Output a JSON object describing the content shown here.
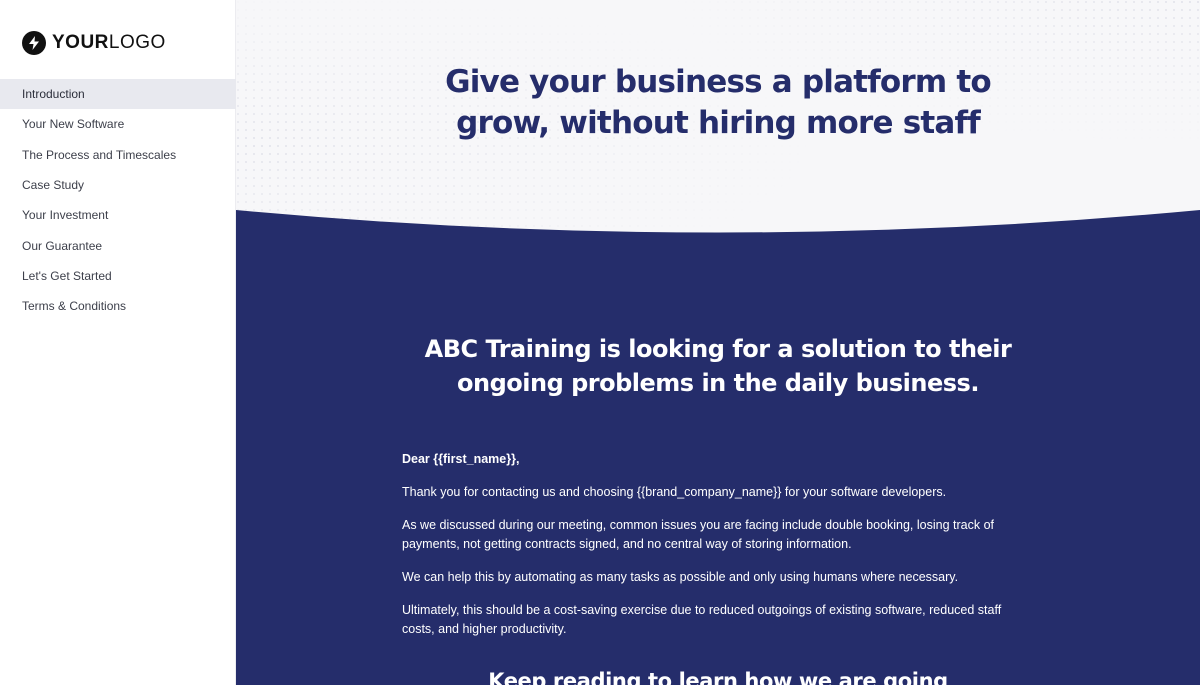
{
  "brand": {
    "logo_bold": "YOUR",
    "logo_light": "LOGO",
    "navy": "#252d6b",
    "hero_bg": "#f7f7f9"
  },
  "sidebar": {
    "items": [
      {
        "label": "Introduction",
        "active": true
      },
      {
        "label": "Your New Software"
      },
      {
        "label": "The Process and Timescales"
      },
      {
        "label": "Case Study"
      },
      {
        "label": "Your Investment"
      },
      {
        "label": "Our Guarantee"
      },
      {
        "label": "Let's Get Started"
      },
      {
        "label": "Terms & Conditions"
      }
    ]
  },
  "hero": {
    "title_line1": "Give your business a platform to",
    "title_line2": "grow, without hiring more staff"
  },
  "section": {
    "heading_line1": "ABC Training is looking for a solution to their",
    "heading_line2": "ongoing problems in the daily business.",
    "greeting": "Dear {{first_name}},",
    "paragraphs": [
      "Thank you for contacting us and choosing {{brand_company_name}} for your software developers.",
      "As we discussed during our meeting, common issues you are facing include double booking, losing track of payments, not getting contracts signed, and no central way of storing information.",
      "We can help this by automating as many tasks as possible and only using humans where necessary.",
      "Ultimately, this should be a cost-saving exercise due to reduced outgoings of existing software, reduced staff costs, and higher productivity."
    ],
    "cta": "Keep reading to learn how we are going"
  }
}
